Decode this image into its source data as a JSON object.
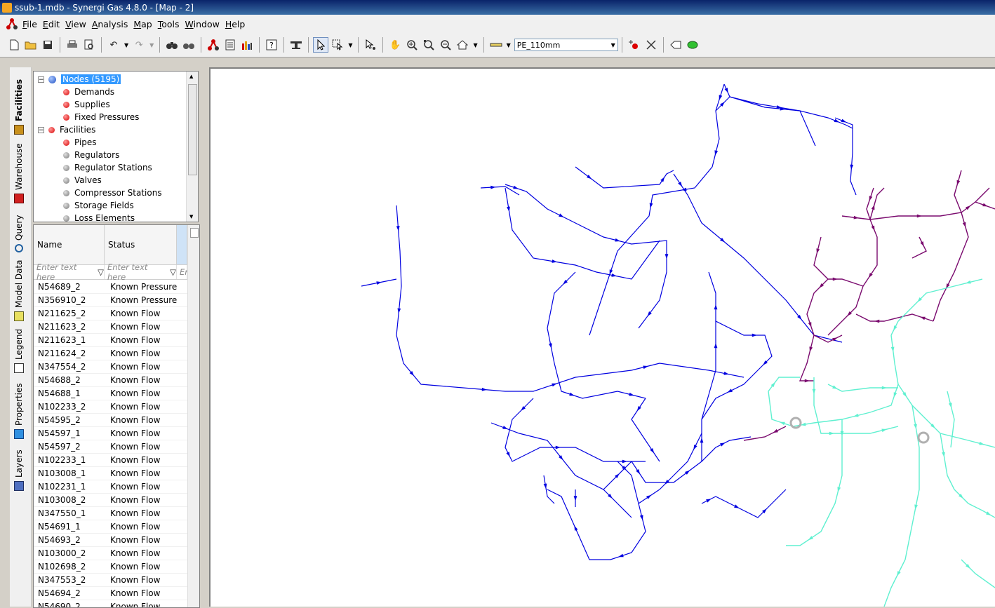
{
  "window": {
    "title": "ssub-1.mdb - Synergi Gas 4.8.0 - [Map - 2]"
  },
  "menu": [
    "File",
    "Edit",
    "View",
    "Analysis",
    "Map",
    "Tools",
    "Window",
    "Help"
  ],
  "toolbar": {
    "pipe_type": "PE_110mm"
  },
  "side_tabs": [
    "Facilities",
    "Warehouse",
    "Query",
    "Model Data",
    "Legend",
    "Properties",
    "Layers"
  ],
  "tree": {
    "items": [
      {
        "label": "Nodes (5195)",
        "level": 0,
        "icon": "blue",
        "expander": "-",
        "selected": true
      },
      {
        "label": "Demands",
        "level": 1,
        "icon": "red"
      },
      {
        "label": "Supplies",
        "level": 1,
        "icon": "red"
      },
      {
        "label": "Fixed Pressures",
        "level": 1,
        "icon": "red"
      },
      {
        "label": "Facilities",
        "level": 0,
        "icon": "red",
        "expander": "-"
      },
      {
        "label": "Pipes",
        "level": 1,
        "icon": "red"
      },
      {
        "label": "Regulators",
        "level": 1,
        "icon": "gray"
      },
      {
        "label": "Regulator Stations",
        "level": 1,
        "icon": "gray"
      },
      {
        "label": "Valves",
        "level": 1,
        "icon": "gray"
      },
      {
        "label": "Compressor Stations",
        "level": 1,
        "icon": "gray"
      },
      {
        "label": "Storage Fields",
        "level": 1,
        "icon": "gray"
      },
      {
        "label": "Loss Elements",
        "level": 1,
        "icon": "gray"
      }
    ]
  },
  "grid": {
    "columns": [
      "Name",
      "Status"
    ],
    "filter_placeholder": "Enter text here",
    "filter_partial": "En",
    "rows": [
      [
        "N54689_2",
        "Known Pressure"
      ],
      [
        "N356910_2",
        "Known Pressure"
      ],
      [
        "N211625_2",
        "Known Flow"
      ],
      [
        "N211623_2",
        "Known Flow"
      ],
      [
        "N211623_1",
        "Known Flow"
      ],
      [
        "N211624_2",
        "Known Flow"
      ],
      [
        "N347554_2",
        "Known Flow"
      ],
      [
        "N54688_2",
        "Known Flow"
      ],
      [
        "N54688_1",
        "Known Flow"
      ],
      [
        "N102233_2",
        "Known Flow"
      ],
      [
        "N54595_2",
        "Known Flow"
      ],
      [
        "N54597_1",
        "Known Flow"
      ],
      [
        "N54597_2",
        "Known Flow"
      ],
      [
        "N102233_1",
        "Known Flow"
      ],
      [
        "N103008_1",
        "Known Flow"
      ],
      [
        "N102231_1",
        "Known Flow"
      ],
      [
        "N103008_2",
        "Known Flow"
      ],
      [
        "N347550_1",
        "Known Flow"
      ],
      [
        "N54691_1",
        "Known Flow"
      ],
      [
        "N54693_2",
        "Known Flow"
      ],
      [
        "N103000_2",
        "Known Flow"
      ],
      [
        "N102698_2",
        "Known Flow"
      ],
      [
        "N347553_2",
        "Known Flow"
      ],
      [
        "N54694_2",
        "Known Flow"
      ],
      [
        "N54690_2",
        "Known Flow"
      ]
    ]
  },
  "map": {
    "colors": {
      "blue_network": "#0000e0",
      "purple_network": "#7a0a6e",
      "cyan_network": "#5ff0d0",
      "station": "#b0b0b0"
    }
  }
}
